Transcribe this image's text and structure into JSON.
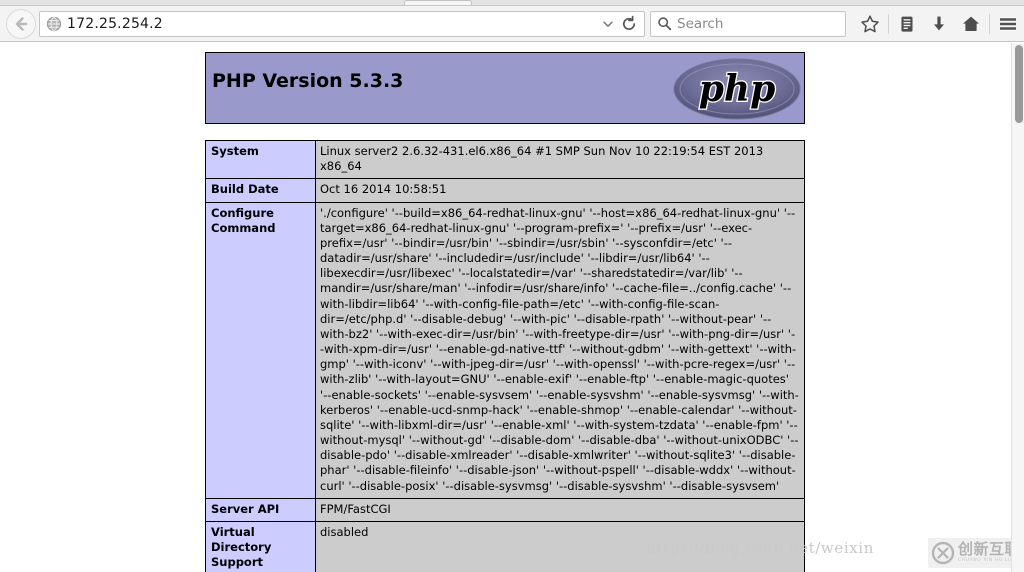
{
  "browser": {
    "back_button": "back-arrow",
    "url_value": "172.25.254.2",
    "url_favicon": "globe-icon",
    "url_dropdown": "chevron-down-icon",
    "reload": "reload-icon",
    "search_placeholder": "Search",
    "search_icon": "magnifier-icon",
    "toolbar_buttons": [
      {
        "name": "bookmark-star-button",
        "icon": "star-icon"
      },
      {
        "name": "library-button",
        "icon": "library-icon"
      },
      {
        "name": "downloads-button",
        "icon": "download-arrow-icon"
      },
      {
        "name": "home-button",
        "icon": "home-icon"
      },
      {
        "name": "menu-button",
        "icon": "hamburger-menu-icon"
      }
    ]
  },
  "page": {
    "header_title": "PHP Version 5.3.3",
    "logo_alt": "php-logo",
    "colors": {
      "header_bg": "#9999cc",
      "label_cell_bg": "#ccccff",
      "value_cell_bg": "#cccccc",
      "border": "#000000"
    },
    "rows": [
      {
        "label": "System",
        "value": "Linux server2 2.6.32-431.el6.x86_64 #1 SMP Sun Nov 10 22:19:54 EST 2013 x86_64"
      },
      {
        "label": "Build Date",
        "value": "Oct 16 2014 10:58:51"
      },
      {
        "label": "Configure Command",
        "value": "'./configure' '--build=x86_64-redhat-linux-gnu' '--host=x86_64-redhat-linux-gnu' '--target=x86_64-redhat-linux-gnu' '--program-prefix=' '--prefix=/usr' '--exec-prefix=/usr' '--bindir=/usr/bin' '--sbindir=/usr/sbin' '--sysconfdir=/etc' '--datadir=/usr/share' '--includedir=/usr/include' '--libdir=/usr/lib64' '--libexecdir=/usr/libexec' '--localstatedir=/var' '--sharedstatedir=/var/lib' '--mandir=/usr/share/man' '--infodir=/usr/share/info' '--cache-file=../config.cache' '--with-libdir=lib64' '--with-config-file-path=/etc' '--with-config-file-scan-dir=/etc/php.d' '--disable-debug' '--with-pic' '--disable-rpath' '--without-pear' '--with-bz2' '--with-exec-dir=/usr/bin' '--with-freetype-dir=/usr' '--with-png-dir=/usr' '--with-xpm-dir=/usr' '--enable-gd-native-ttf' '--without-gdbm' '--with-gettext' '--with-gmp' '--with-iconv' '--with-jpeg-dir=/usr' '--with-openssl' '--with-pcre-regex=/usr' '--with-zlib' '--with-layout=GNU' '--enable-exif' '--enable-ftp' '--enable-magic-quotes' '--enable-sockets' '--enable-sysvsem' '--enable-sysvshm' '--enable-sysvmsg' '--with-kerberos' '--enable-ucd-snmp-hack' '--enable-shmop' '--enable-calendar' '--without-sqlite' '--with-libxml-dir=/usr' '--enable-xml' '--with-system-tzdata' '--enable-fpm' '--without-mysql' '--without-gd' '--disable-dom' '--disable-dba' '--without-unixODBC' '--disable-pdo' '--disable-xmlreader' '--disable-xmlwriter' '--without-sqlite3' '--disable-phar' '--disable-fileinfo' '--disable-json' '--without-pspell' '--disable-wddx' '--without-curl' '--disable-posix' '--disable-sysvmsg' '--disable-sysvshm' '--disable-sysvsem'"
      },
      {
        "label": "Server API",
        "value": "FPM/FastCGI"
      },
      {
        "label": "Virtual Directory Support",
        "value": "disabled"
      }
    ]
  },
  "watermarks": {
    "url_text": "https://blog.csdn.net/weixin",
    "badge_main": "创新互联",
    "badge_sub": "CHUANG XIN HU LIAN",
    "badge_icon": "cx-circle-logo-icon"
  }
}
